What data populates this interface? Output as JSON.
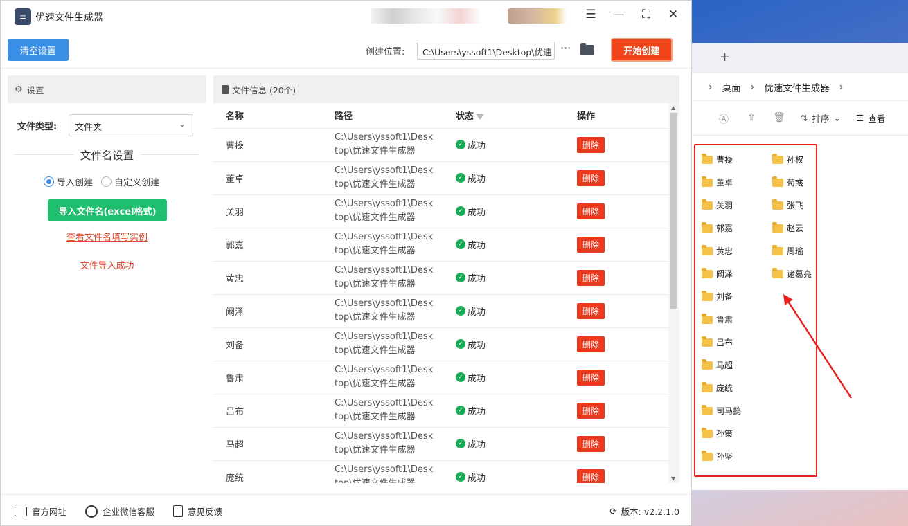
{
  "app": {
    "title": "优速文件生成器",
    "logo_text": "≡",
    "clear_button": "清空设置",
    "location_label": "创建位置:",
    "location_value": "C:\\Users\\yssoft1\\Desktop\\优速",
    "more_label": "···",
    "start_button": "开始创建",
    "controls": {
      "menu": "☰",
      "minimize": "—",
      "maximize": "⛶",
      "close": "✕"
    }
  },
  "settings": {
    "header": "设置",
    "type_label": "文件类型:",
    "type_value": "文件夹",
    "section_title": "文件名设置",
    "radio_import": "导入创建",
    "radio_custom": "自定义创建",
    "import_button": "导入文件名(excel格式)",
    "example_link": "查看文件名填写实例",
    "import_status": "文件导入成功"
  },
  "file_info": {
    "header": "文件信息 (20个)",
    "columns": {
      "name": "名称",
      "path": "路径",
      "status": "状态",
      "action": "操作"
    },
    "path_line1": "C:\\Users\\yssoft1\\Desk",
    "path_line2": "top\\优速文件生成器",
    "status_text": "成功",
    "delete_label": "删除",
    "rows": [
      "曹操",
      "董卓",
      "关羽",
      "郭嘉",
      "黄忠",
      "阚泽",
      "刘备",
      "鲁肃",
      "吕布",
      "马超",
      "庞统"
    ]
  },
  "footer": {
    "website": "官方网址",
    "wechat": "企业微信客服",
    "feedback": "意见反馈",
    "version": "版本: v2.2.1.0"
  },
  "explorer": {
    "breadcrumb": [
      "桌面",
      "优速文件生成器"
    ],
    "sort_label": "排序",
    "view_label": "查看",
    "folders_col1": [
      "曹操",
      "董卓",
      "关羽",
      "郭嘉",
      "黄忠",
      "阚泽",
      "刘备",
      "鲁肃",
      "吕布",
      "马超",
      "庞统",
      "司马懿",
      "孙策",
      "孙坚"
    ],
    "folders_col2": [
      "孙权",
      "荀彧",
      "张飞",
      "赵云",
      "周瑜",
      "诸葛亮"
    ]
  }
}
